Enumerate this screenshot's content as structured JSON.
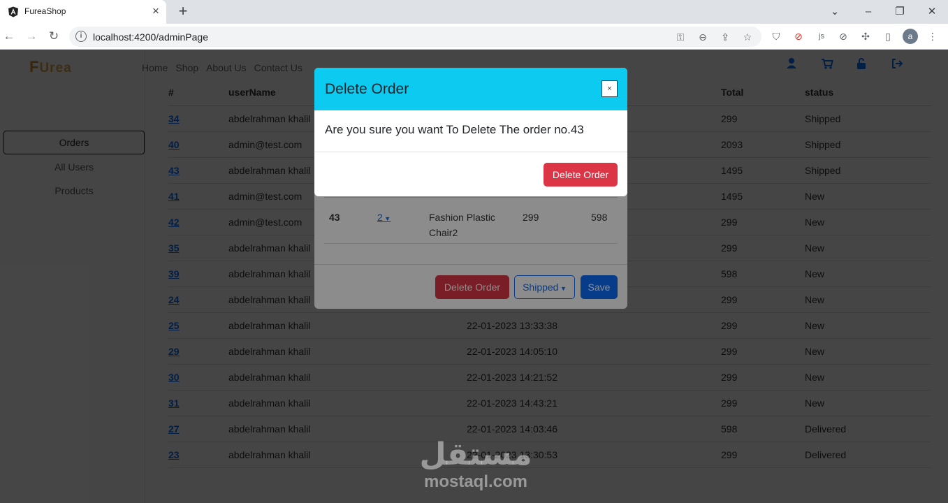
{
  "browser": {
    "tab_title": "FureaShop",
    "url": "localhost:4200/adminPage",
    "avatar_letter": "a"
  },
  "header": {
    "logo_f": "F",
    "logo_rest": "Urea",
    "nav": [
      "Home",
      "Shop",
      "About Us",
      "Contact Us"
    ]
  },
  "sidebar": {
    "items": [
      "Orders",
      "All Users",
      "Products"
    ]
  },
  "orders_table": {
    "headers": [
      "#",
      "userName",
      "",
      "Total",
      "status"
    ],
    "rows": [
      {
        "id": "34",
        "user": "abdelrahman khalil",
        "date": "",
        "total": "299",
        "status": "Shipped"
      },
      {
        "id": "40",
        "user": "admin@test.com",
        "date": "",
        "total": "2093",
        "status": "Shipped"
      },
      {
        "id": "43",
        "user": "abdelrahman khalil",
        "date": "",
        "total": "1495",
        "status": "Shipped"
      },
      {
        "id": "41",
        "user": "admin@test.com",
        "date": "",
        "total": "1495",
        "status": "New"
      },
      {
        "id": "42",
        "user": "admin@test.com",
        "date": "",
        "total": "299",
        "status": "New"
      },
      {
        "id": "35",
        "user": "abdelrahman khalil",
        "date": "",
        "total": "299",
        "status": "New"
      },
      {
        "id": "39",
        "user": "abdelrahman khalil",
        "date": "",
        "total": "598",
        "status": "New"
      },
      {
        "id": "24",
        "user": "abdelrahman khalil",
        "date": "",
        "total": "299",
        "status": "New"
      },
      {
        "id": "25",
        "user": "abdelrahman khalil",
        "date": "22-01-2023 13:33:38",
        "total": "299",
        "status": "New"
      },
      {
        "id": "29",
        "user": "abdelrahman khalil",
        "date": "22-01-2023 14:05:10",
        "total": "299",
        "status": "New"
      },
      {
        "id": "30",
        "user": "abdelrahman khalil",
        "date": "22-01-2023 14:21:52",
        "total": "299",
        "status": "New"
      },
      {
        "id": "31",
        "user": "abdelrahman khalil",
        "date": "22-01-2023 14:43:21",
        "total": "299",
        "status": "New"
      },
      {
        "id": "27",
        "user": "abdelrahman khalil",
        "date": "22-01-2023 14:03:46",
        "total": "598",
        "status": "Delivered"
      },
      {
        "id": "23",
        "user": "abdelrahman khalil",
        "date": "22-01-2023 13:30:53",
        "total": "299",
        "status": "Delivered"
      }
    ]
  },
  "order_detail_modal": {
    "row": {
      "order": "43",
      "qty": "2",
      "product": "Fashion Plastic Chair2",
      "price": "299",
      "subtotal": "598"
    },
    "delete_label": "Delete Order",
    "status_label": "Shipped",
    "save_label": "Save"
  },
  "delete_modal": {
    "title": "Delete Order",
    "close_label": "×",
    "message": "Are you sure you want To Delete The order no.43",
    "confirm_label": "Delete Order"
  },
  "watermark": {
    "arabic": "مستقل",
    "latin": "mostaql.com"
  },
  "colors": {
    "modal_header": "#0dcaf0",
    "danger": "#dc3545",
    "primary": "#0d6efd"
  }
}
